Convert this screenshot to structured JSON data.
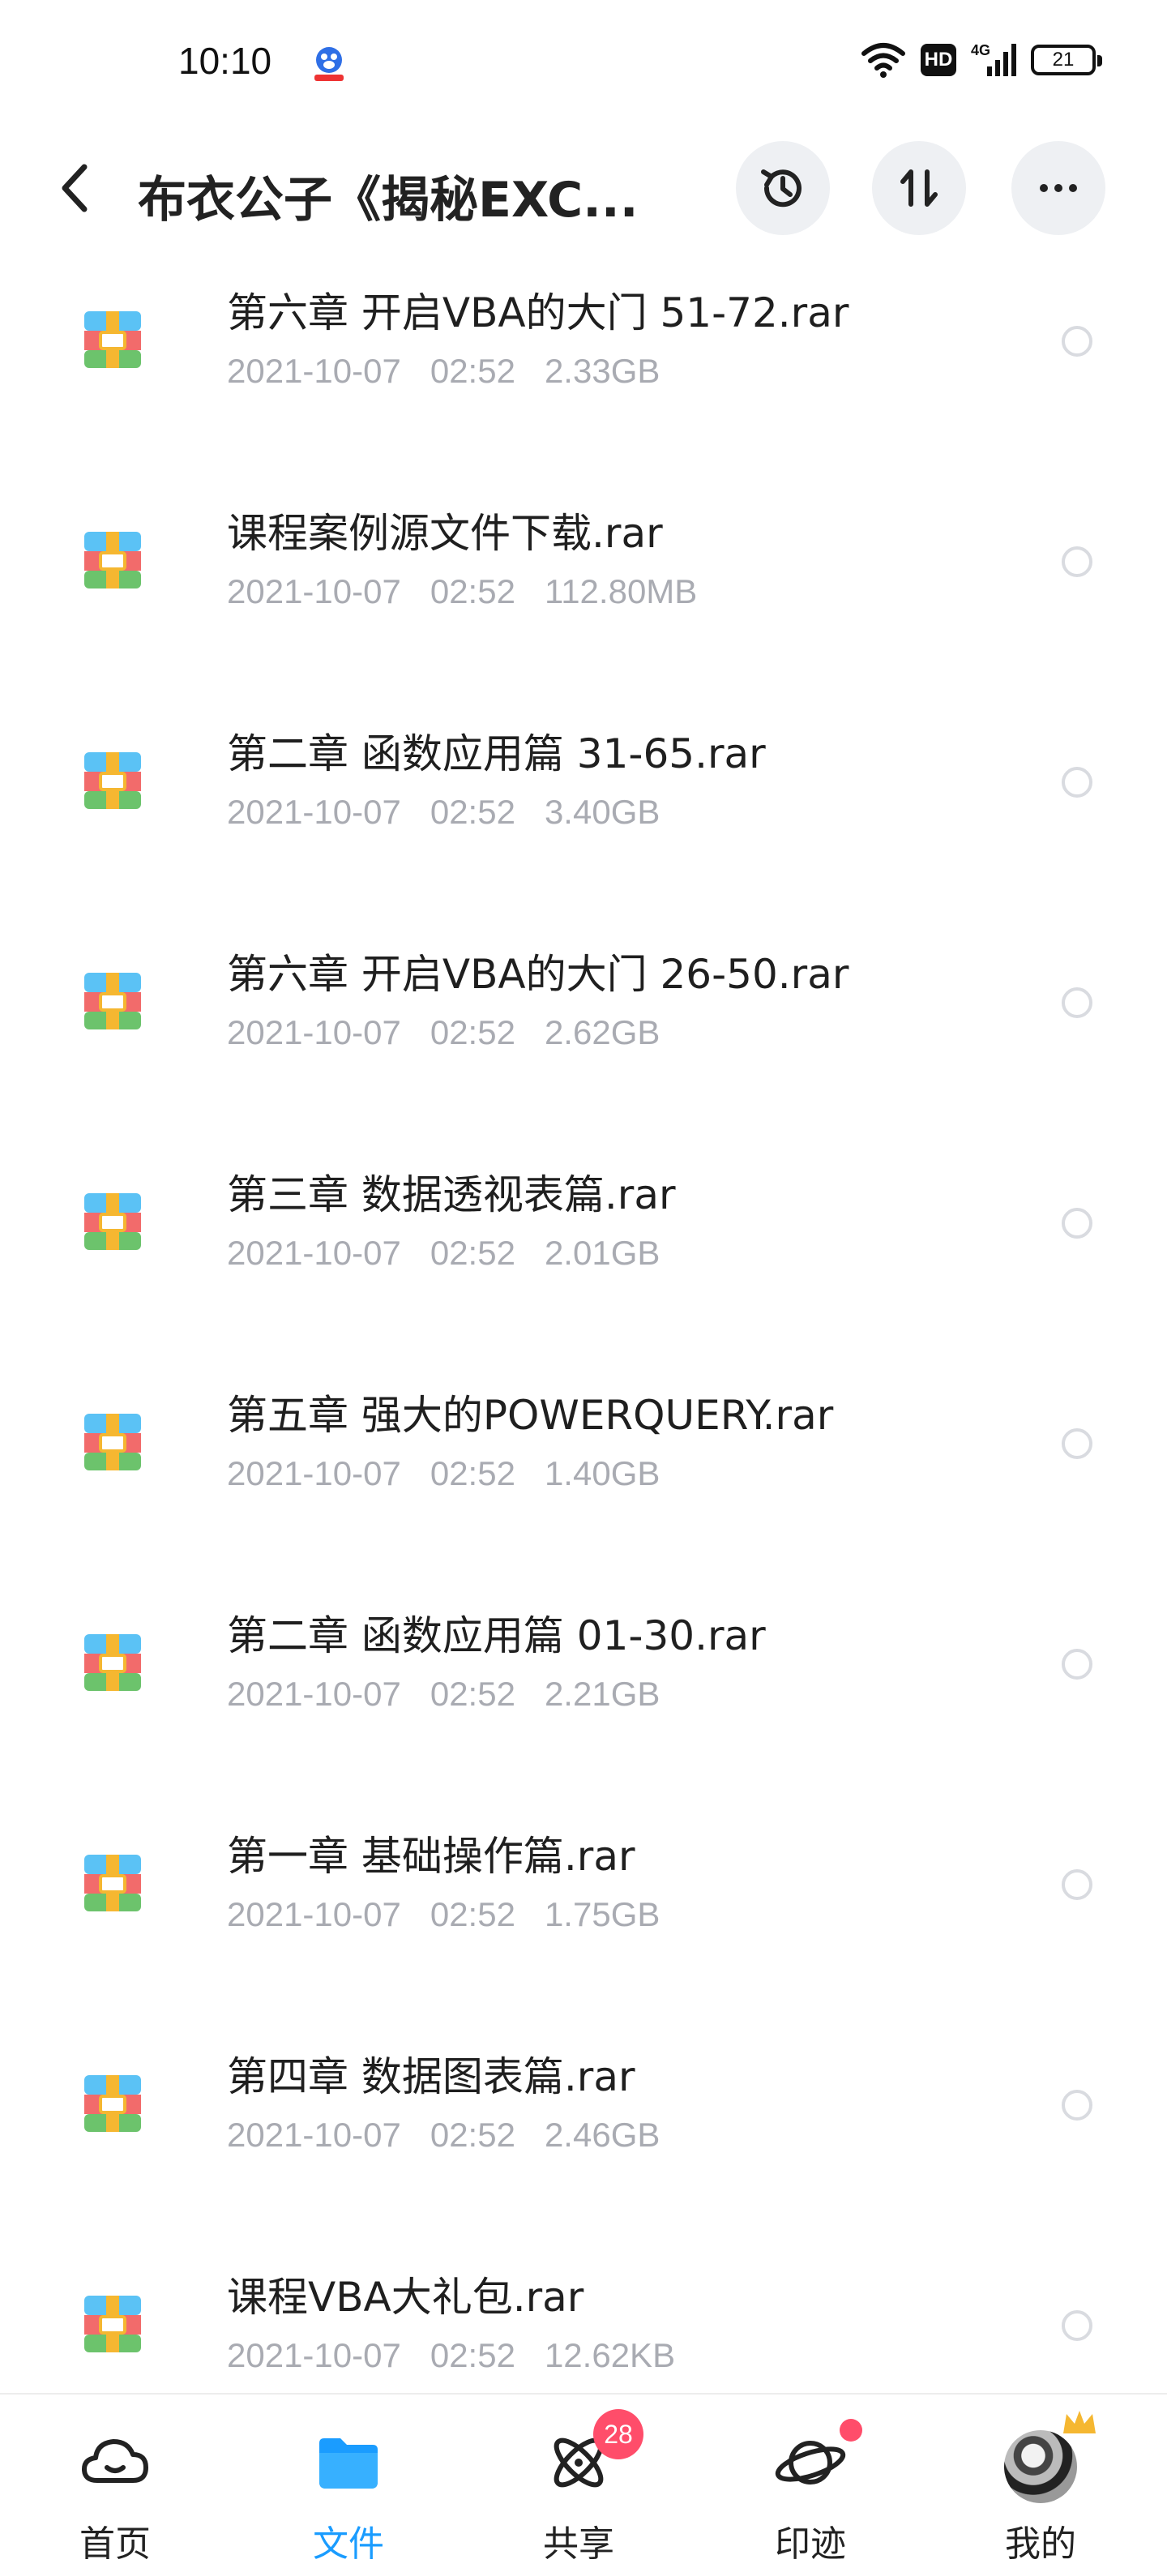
{
  "status_bar": {
    "time": "10:10",
    "hd": "HD",
    "battery": "21"
  },
  "header": {
    "title": "布衣公子《揭秘EXC...",
    "icons": [
      "back-icon",
      "history-icon",
      "sort-icon",
      "more-icon"
    ]
  },
  "files": [
    {
      "name": "第六章 开启VBA的大门 51-72.rar",
      "date": "2021-10-07",
      "time": "02:52",
      "size": "2.33GB"
    },
    {
      "name": "课程案例源文件下载.rar",
      "date": "2021-10-07",
      "time": "02:52",
      "size": "112.80MB"
    },
    {
      "name": "第二章 函数应用篇 31-65.rar",
      "date": "2021-10-07",
      "time": "02:52",
      "size": "3.40GB"
    },
    {
      "name": "第六章 开启VBA的大门 26-50.rar",
      "date": "2021-10-07",
      "time": "02:52",
      "size": "2.62GB"
    },
    {
      "name": "第三章 数据透视表篇.rar",
      "date": "2021-10-07",
      "time": "02:52",
      "size": "2.01GB"
    },
    {
      "name": "第五章 强大的POWERQUERY.rar",
      "date": "2021-10-07",
      "time": "02:52",
      "size": "1.40GB"
    },
    {
      "name": "第二章 函数应用篇 01-30.rar",
      "date": "2021-10-07",
      "time": "02:52",
      "size": "2.21GB"
    },
    {
      "name": "第一章 基础操作篇.rar",
      "date": "2021-10-07",
      "time": "02:52",
      "size": "1.75GB"
    },
    {
      "name": "第四章 数据图表篇.rar",
      "date": "2021-10-07",
      "time": "02:52",
      "size": "2.46GB"
    },
    {
      "name": "课程VBA大礼包.rar",
      "date": "2021-10-07",
      "time": "02:52",
      "size": "12.62KB"
    }
  ],
  "bottom_nav": [
    {
      "label": "首页",
      "icon": "cloud-icon",
      "active": false
    },
    {
      "label": "文件",
      "icon": "folder-icon",
      "active": true
    },
    {
      "label": "共享",
      "icon": "atom-icon",
      "active": false,
      "badge": "28"
    },
    {
      "label": "印迹",
      "icon": "planet-icon",
      "active": false,
      "dot": true
    },
    {
      "label": "我的",
      "icon": "avatar",
      "active": false
    }
  ],
  "colors": {
    "accent": "#1a9cff",
    "meta_text": "#a9abb2",
    "badge": "#ff4d6a"
  }
}
